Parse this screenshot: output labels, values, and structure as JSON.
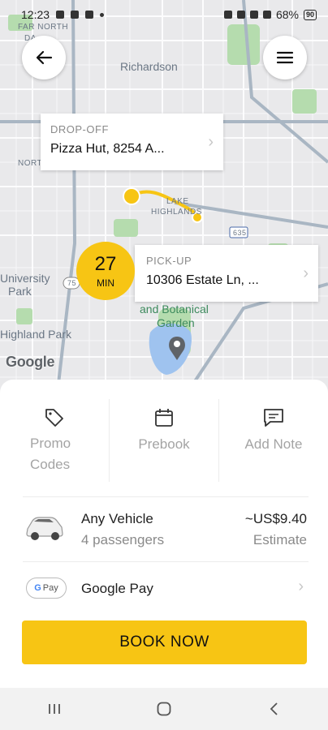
{
  "status_bar": {
    "time": "12:23",
    "battery": "68%",
    "battery_level": "90"
  },
  "map": {
    "labels": {
      "far_north": "FAR NORTH",
      "da": "DA",
      "richardson": "Richardson",
      "north": "NORT",
      "lake": "LAKE",
      "highlands": "HIGHLANDS",
      "university": "University",
      "park": "Park",
      "highland_park": "Highland Park",
      "botanical1": "and Botanical",
      "botanical2": "Garden",
      "hwy_635": "635",
      "hwy_75": "75"
    },
    "google_logo": "Google",
    "dropoff": {
      "tag": "DROP-OFF",
      "address": "Pizza Hut, 8254 A..."
    },
    "pickup": {
      "tag": "PICK-UP",
      "address": "10306 Estate Ln, ..."
    },
    "eta": {
      "minutes": "27",
      "unit": "MIN"
    }
  },
  "options": {
    "promo": "Promo Codes",
    "promo_line1": "Promo",
    "promo_line2": "Codes",
    "prebook": "Prebook",
    "add_note": "Add Note"
  },
  "vehicle": {
    "name": "Any Vehicle",
    "passengers": "4 passengers",
    "price": "~US$9.40",
    "price_note": "Estimate"
  },
  "payment": {
    "badge_g": "G",
    "badge_pay": "Pay",
    "name": "Google Pay"
  },
  "book_button": "BOOK NOW",
  "colors": {
    "accent": "#f7c514",
    "map_bg": "#e8e8e8",
    "park_green": "#a8d5a2",
    "water": "#9fc3ef"
  },
  "icons": {
    "back": "arrow-left-icon",
    "menu": "hamburger-menu-icon",
    "promo": "tag-icon",
    "prebook": "calendar-icon",
    "note": "message-icon",
    "chevron": "chevron-right-icon"
  }
}
